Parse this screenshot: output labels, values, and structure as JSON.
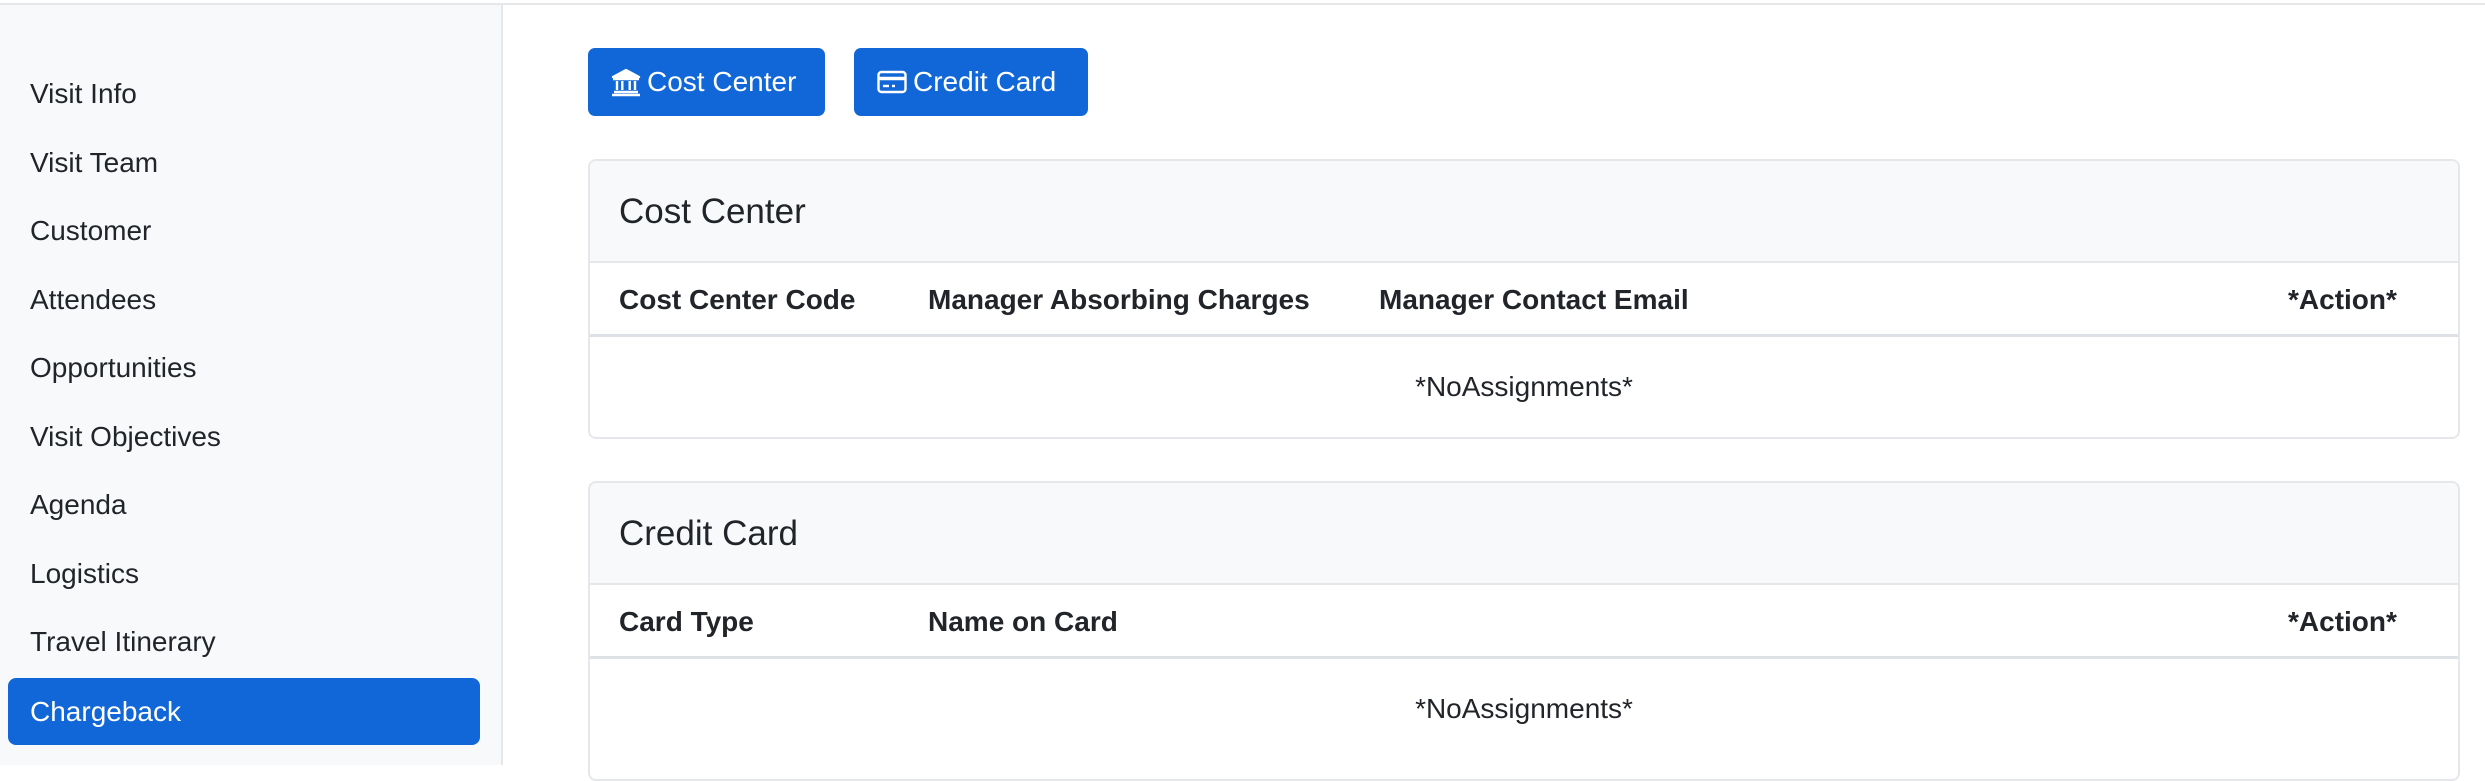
{
  "sidebar": {
    "items": [
      {
        "label": "Visit Info"
      },
      {
        "label": "Visit Team"
      },
      {
        "label": "Customer"
      },
      {
        "label": "Attendees"
      },
      {
        "label": "Opportunities"
      },
      {
        "label": "Visit Objectives"
      },
      {
        "label": "Agenda"
      },
      {
        "label": "Logistics"
      },
      {
        "label": "Travel Itinerary"
      },
      {
        "label": "Chargeback"
      }
    ],
    "active": "Chargeback"
  },
  "toolbar": {
    "cost_center_button": {
      "label": "Cost Center",
      "icon": "bank-icon"
    },
    "credit_card_button": {
      "label": "Credit Card",
      "icon": "credit-card-icon"
    }
  },
  "cost_center_card": {
    "title": "Cost Center",
    "columns": [
      "Cost Center Code",
      "Manager Absorbing Charges",
      "Manager Contact Email",
      "*Action*"
    ],
    "empty_text": "*NoAssignments*"
  },
  "credit_card_card": {
    "title": "Credit Card",
    "columns": [
      "Card Type",
      "Name on Card",
      "*Action*"
    ],
    "empty_text": "*NoAssignments*"
  },
  "colors": {
    "accent": "#1167d8",
    "sidebar_bg": "#f8f9fa",
    "border": "#e5e7ea"
  }
}
